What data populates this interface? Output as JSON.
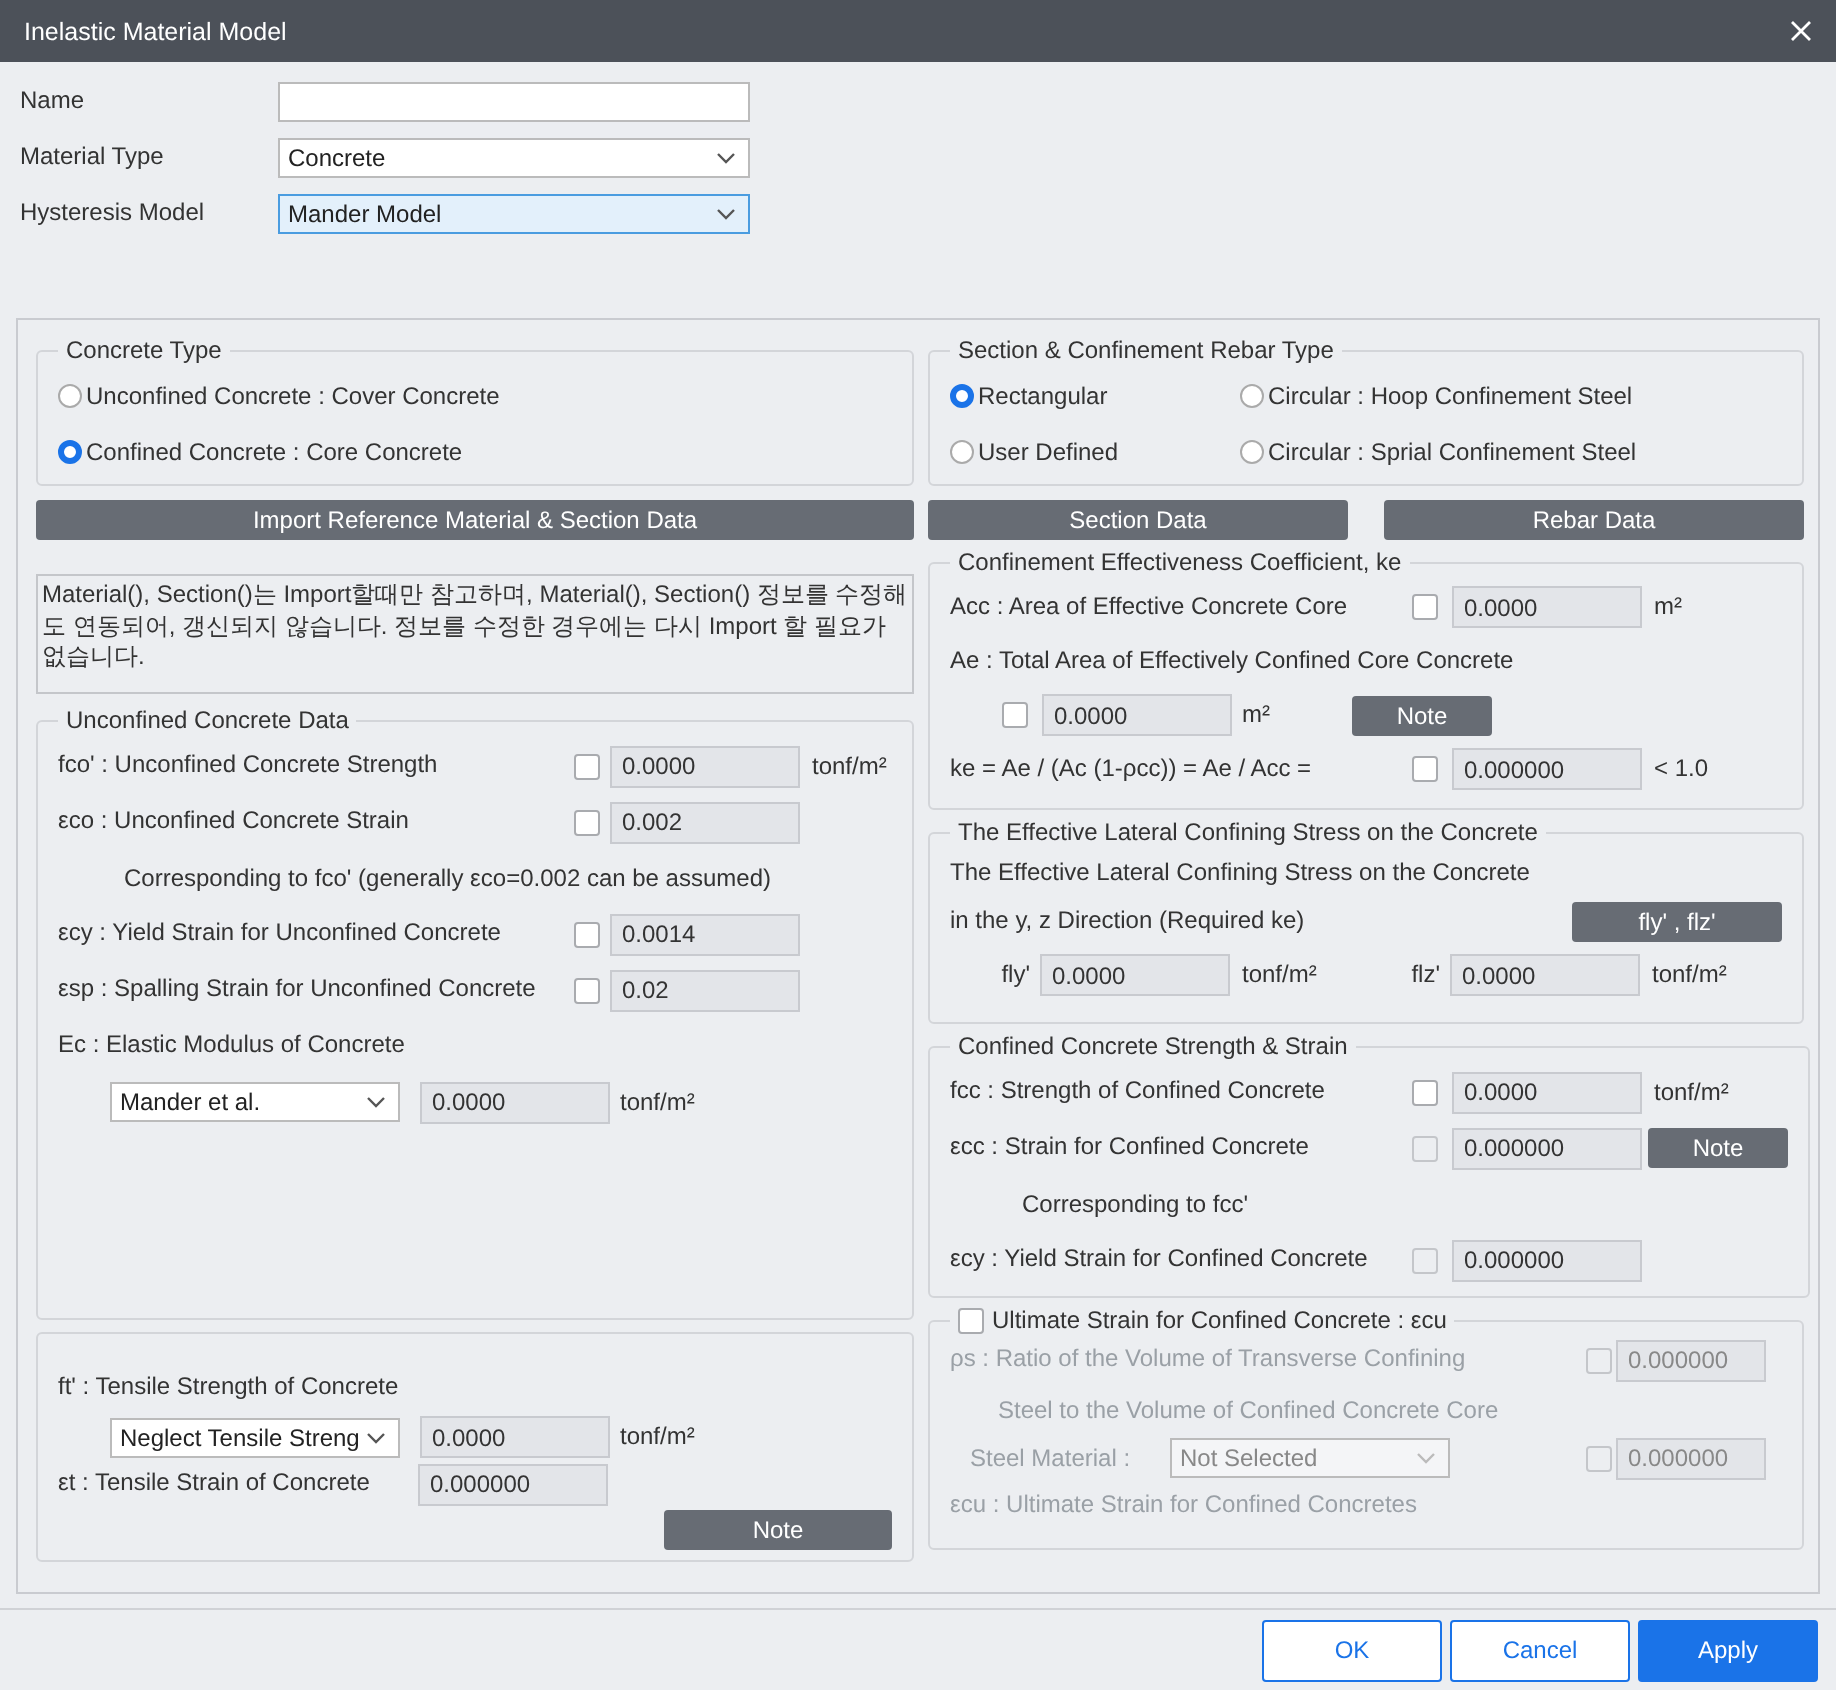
{
  "window": {
    "title": "Inelastic Material Model"
  },
  "top_fields": [
    {
      "label": "Name",
      "kind": "input"
    },
    {
      "label": "Material Type",
      "kind": "select",
      "value": "Concrete",
      "focused": false
    },
    {
      "label": "Hysteresis Model",
      "kind": "select",
      "value": "Mander Model",
      "focused": true
    }
  ],
  "concrete_type": {
    "title": "Concrete Type",
    "options": [
      {
        "label": "Unconfined Concrete : Cover Concrete",
        "selected": false
      },
      {
        "label": "Confined Concrete : Core Concrete",
        "selected": true
      }
    ]
  },
  "import_button": "Import Reference Material & Section Data",
  "note_text": "Material(), Section()는 Import할때만 참고하며, Material(), Section() 정보를 수정해도 연동되어, 갱신되지 않습니다. 정보를 수정한 경우에는 다시 Import 할 필요가 없습니다.",
  "unconfined": {
    "title": "Unconfined Concrete Data",
    "rows": [
      {
        "kind": "value",
        "label": "fco' : Unconfined Concrete Strength",
        "checked": false,
        "value": "0.0000",
        "unit": "tonf/m²"
      },
      {
        "kind": "value",
        "label": "εco : Unconfined Concrete Strain",
        "checked": false,
        "value": "0.002"
      },
      {
        "kind": "note",
        "label": "Corresponding to fco' (generally εco=0.002 can be assumed)"
      },
      {
        "kind": "value",
        "label": "εcy : Yield Strain for Unconfined Concrete",
        "checked": false,
        "value": "0.0014"
      },
      {
        "kind": "value",
        "label": "εsp : Spalling Strain for Unconfined Concrete",
        "checked": false,
        "value": "0.02"
      },
      {
        "kind": "heading",
        "label": "Ec : Elastic Modulus of Concrete"
      },
      {
        "kind": "select",
        "option": "Mander et al.",
        "value": "0.0000",
        "unit": "tonf/m²"
      }
    ]
  },
  "tensile": {
    "rows": [
      {
        "kind": "heading",
        "label": "ft' : Tensile Strength of Concrete"
      },
      {
        "kind": "select",
        "option": "Neglect Tensile Streng",
        "value": "0.0000",
        "unit": "tonf/m²"
      },
      {
        "kind": "plain",
        "label": "εt : Tensile Strain of Concrete",
        "value": "0.000000"
      }
    ],
    "button": "Note"
  },
  "section_type": {
    "title": "Section & Confinement Rebar Type",
    "options": [
      {
        "label": "Rectangular",
        "selected": true
      },
      {
        "label": "Circular : Hoop Confinement Steel",
        "selected": false
      },
      {
        "label": "User Defined",
        "selected": false
      },
      {
        "label": "Circular : Sprial Confinement Steel",
        "selected": false
      }
    ]
  },
  "data_buttons": [
    "Section Data",
    "Rebar Data"
  ],
  "confinement": {
    "title": "Confinement Effectiveness Coefficient, ke",
    "rows": [
      {
        "kind": "value",
        "label": "Acc : Area of Effective Concrete Core",
        "checked": false,
        "value": "0.0000",
        "unit": "m²"
      },
      {
        "kind": "heading",
        "label": "Ae : Total Area of Effectively Confined Core Concrete"
      },
      {
        "kind": "indent",
        "checked": false,
        "value": "0.0000",
        "unit": "m²",
        "button": "Note"
      },
      {
        "kind": "value",
        "label": "ke = Ae / (Ac (1-ρcc)) = Ae / Acc =",
        "checked": false,
        "value": "0.000000",
        "unit": "< 1.0"
      }
    ]
  },
  "lateral": {
    "title": "The Effective Lateral Confining Stress on the Concrete",
    "line_1": "The Effective Lateral Confining Stress on the Concrete",
    "line_2": "in the y, z Direction (Required ke)",
    "button": "fly' , flz'",
    "pair": [
      {
        "label": "fly'",
        "value": "0.0000",
        "unit": "tonf/m²"
      },
      {
        "label": "flz'",
        "value": "0.0000",
        "unit": "tonf/m²"
      }
    ]
  },
  "confined": {
    "title": "Confined Concrete Strength & Strain",
    "rows": [
      {
        "kind": "value",
        "label": "fcc : Strength of Confined Concrete",
        "checked": false,
        "disabled": false,
        "value": "0.0000",
        "unit": "tonf/m²"
      },
      {
        "kind": "value",
        "label": "εcc : Strain for Confined Concrete",
        "checked": false,
        "disabled": true,
        "value": "0.000000",
        "button": "Note"
      },
      {
        "kind": "note",
        "label": "Corresponding to fcc'"
      },
      {
        "kind": "value",
        "label": "εcy : Yield Strain for Confined Concrete",
        "checked": false,
        "disabled": true,
        "value": "0.000000"
      }
    ]
  },
  "ultimate": {
    "title": "Ultimate Strain for Confined Concrete : εcu",
    "checked": false,
    "rows": [
      {
        "kind": "value",
        "label": "ρs : Ratio of the Volume of Transverse Confining",
        "checked": false,
        "value": "0.000000"
      },
      {
        "kind": "note",
        "label": "Steel  to the Volume of Confined Concrete Core"
      },
      {
        "kind": "material",
        "label": "Steel Material :",
        "option": "Not Selected",
        "checked": false,
        "value": "0.000000"
      },
      {
        "kind": "heading",
        "label": "εcu : Ultimate Strain for Confined Concretes"
      }
    ]
  },
  "footer_buttons": [
    {
      "label": "OK",
      "kind": "outline"
    },
    {
      "label": "Cancel",
      "kind": "outline"
    },
    {
      "label": "Apply",
      "kind": "primary"
    }
  ]
}
